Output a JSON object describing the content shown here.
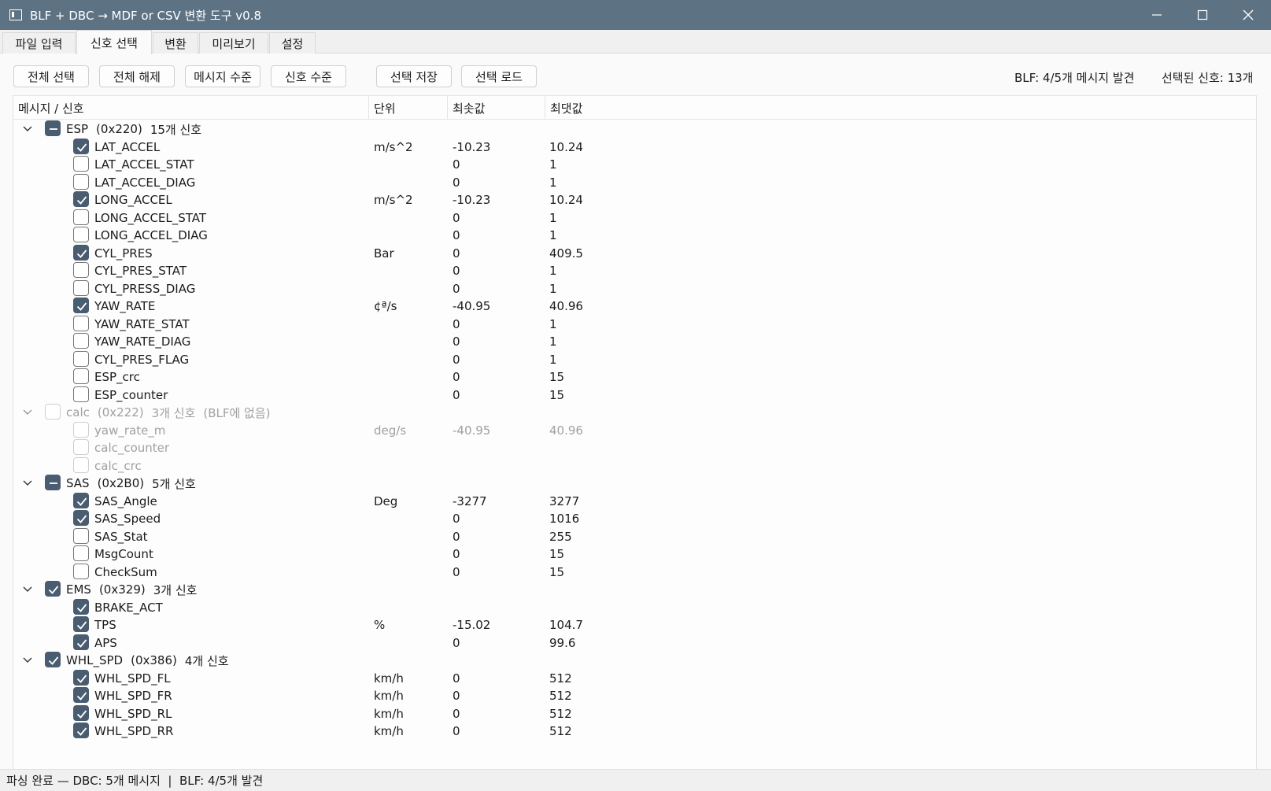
{
  "window": {
    "title": "BLF + DBC → MDF or CSV 변환 도구 v0.8",
    "minimize_icon": "minimize-icon",
    "maximize_icon": "maximize-icon",
    "close_icon": "close-icon"
  },
  "tabs": [
    {
      "label": "파일 입력"
    },
    {
      "label": "신호 선택",
      "active": true
    },
    {
      "label": "변환"
    },
    {
      "label": "미리보기"
    },
    {
      "label": "설정"
    }
  ],
  "toolbar": {
    "select_all": "전체 선택",
    "deselect_all": "전체 해제",
    "message_level": "메시지 수준",
    "signal_level": "신호 수준",
    "save_selection": "선택 저장",
    "load_selection": "선택 로드",
    "blf_info": "BLF: 4/5개 메시지 발견",
    "selected_count": "선택된 신호: 13개"
  },
  "tree": {
    "columns": [
      "메시지 / 신호",
      "단위",
      "최솟값",
      "최댓값"
    ],
    "accent_color": "#4a5d70",
    "rows": [
      {
        "level": 0,
        "name": "ESP",
        "id": "(0x220)",
        "count": "15개 신호",
        "note": "",
        "state": "partial",
        "disabled": false
      },
      {
        "level": 1,
        "name": "LAT_ACCEL",
        "unit": "m/s^2",
        "min": "-10.23",
        "max": "10.24",
        "state": "checked",
        "disabled": false
      },
      {
        "level": 1,
        "name": "LAT_ACCEL_STAT",
        "unit": "",
        "min": "0",
        "max": "1",
        "state": "unchecked",
        "disabled": false
      },
      {
        "level": 1,
        "name": "LAT_ACCEL_DIAG",
        "unit": "",
        "min": "0",
        "max": "1",
        "state": "unchecked",
        "disabled": false
      },
      {
        "level": 1,
        "name": "LONG_ACCEL",
        "unit": "m/s^2",
        "min": "-10.23",
        "max": "10.24",
        "state": "checked",
        "disabled": false
      },
      {
        "level": 1,
        "name": "LONG_ACCEL_STAT",
        "unit": "",
        "min": "0",
        "max": "1",
        "state": "unchecked",
        "disabled": false
      },
      {
        "level": 1,
        "name": "LONG_ACCEL_DIAG",
        "unit": "",
        "min": "0",
        "max": "1",
        "state": "unchecked",
        "disabled": false
      },
      {
        "level": 1,
        "name": "CYL_PRES",
        "unit": "Bar",
        "min": "0",
        "max": "409.5",
        "state": "checked",
        "disabled": false
      },
      {
        "level": 1,
        "name": "CYL_PRES_STAT",
        "unit": "",
        "min": "0",
        "max": "1",
        "state": "unchecked",
        "disabled": false
      },
      {
        "level": 1,
        "name": "CYL_PRESS_DIAG",
        "unit": "",
        "min": "0",
        "max": "1",
        "state": "unchecked",
        "disabled": false
      },
      {
        "level": 1,
        "name": "YAW_RATE",
        "unit": "¢ª/s",
        "min": "-40.95",
        "max": "40.96",
        "state": "checked",
        "disabled": false
      },
      {
        "level": 1,
        "name": "YAW_RATE_STAT",
        "unit": "",
        "min": "0",
        "max": "1",
        "state": "unchecked",
        "disabled": false
      },
      {
        "level": 1,
        "name": "YAW_RATE_DIAG",
        "unit": "",
        "min": "0",
        "max": "1",
        "state": "unchecked",
        "disabled": false
      },
      {
        "level": 1,
        "name": "CYL_PRES_FLAG",
        "unit": "",
        "min": "0",
        "max": "1",
        "state": "unchecked",
        "disabled": false
      },
      {
        "level": 1,
        "name": "ESP_crc",
        "unit": "",
        "min": "0",
        "max": "15",
        "state": "unchecked",
        "disabled": false
      },
      {
        "level": 1,
        "name": "ESP_counter",
        "unit": "",
        "min": "0",
        "max": "15",
        "state": "unchecked",
        "disabled": false
      },
      {
        "level": 0,
        "name": "calc",
        "id": "(0x222)",
        "count": "3개 신호",
        "note": "(BLF에 없음)",
        "state": "unchecked",
        "disabled": true
      },
      {
        "level": 1,
        "name": "yaw_rate_m",
        "unit": "deg/s",
        "min": "-40.95",
        "max": "40.96",
        "state": "unchecked",
        "disabled": true
      },
      {
        "level": 1,
        "name": "calc_counter",
        "unit": "",
        "min": "",
        "max": "",
        "state": "unchecked",
        "disabled": true
      },
      {
        "level": 1,
        "name": "calc_crc",
        "unit": "",
        "min": "",
        "max": "",
        "state": "unchecked",
        "disabled": true
      },
      {
        "level": 0,
        "name": "SAS",
        "id": "(0x2B0)",
        "count": "5개 신호",
        "note": "",
        "state": "partial",
        "disabled": false
      },
      {
        "level": 1,
        "name": "SAS_Angle",
        "unit": "Deg",
        "min": "-3277",
        "max": "3277",
        "state": "checked",
        "disabled": false
      },
      {
        "level": 1,
        "name": "SAS_Speed",
        "unit": "",
        "min": "0",
        "max": "1016",
        "state": "checked",
        "disabled": false
      },
      {
        "level": 1,
        "name": "SAS_Stat",
        "unit": "",
        "min": "0",
        "max": "255",
        "state": "unchecked",
        "disabled": false
      },
      {
        "level": 1,
        "name": "MsgCount",
        "unit": "",
        "min": "0",
        "max": "15",
        "state": "unchecked",
        "disabled": false
      },
      {
        "level": 1,
        "name": "CheckSum",
        "unit": "",
        "min": "0",
        "max": "15",
        "state": "unchecked",
        "disabled": false
      },
      {
        "level": 0,
        "name": "EMS",
        "id": "(0x329)",
        "count": "3개 신호",
        "note": "",
        "state": "checked",
        "disabled": false
      },
      {
        "level": 1,
        "name": "BRAKE_ACT",
        "unit": "",
        "min": "",
        "max": "",
        "state": "checked",
        "disabled": false
      },
      {
        "level": 1,
        "name": "TPS",
        "unit": "%",
        "min": "-15.02",
        "max": "104.7",
        "state": "checked",
        "disabled": false
      },
      {
        "level": 1,
        "name": "APS",
        "unit": "",
        "min": "0",
        "max": "99.6",
        "state": "checked",
        "disabled": false
      },
      {
        "level": 0,
        "name": "WHL_SPD",
        "id": "(0x386)",
        "count": "4개 신호",
        "note": "",
        "state": "checked",
        "disabled": false
      },
      {
        "level": 1,
        "name": "WHL_SPD_FL",
        "unit": "km/h",
        "min": "0",
        "max": "512",
        "state": "checked",
        "disabled": false
      },
      {
        "level": 1,
        "name": "WHL_SPD_FR",
        "unit": "km/h",
        "min": "0",
        "max": "512",
        "state": "checked",
        "disabled": false
      },
      {
        "level": 1,
        "name": "WHL_SPD_RL",
        "unit": "km/h",
        "min": "0",
        "max": "512",
        "state": "checked",
        "disabled": false
      },
      {
        "level": 1,
        "name": "WHL_SPD_RR",
        "unit": "km/h",
        "min": "0",
        "max": "512",
        "state": "checked",
        "disabled": false
      }
    ]
  },
  "status": {
    "text": "파싱 완료 — DBC: 5개 메시지  |  BLF: 4/5개 발견"
  }
}
